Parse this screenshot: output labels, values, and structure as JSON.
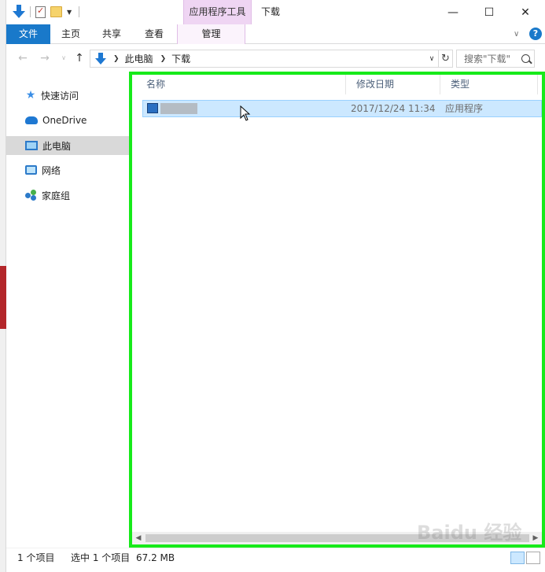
{
  "title_bar": {
    "contextual_tab_group": "应用程序工具",
    "window_title": "下载",
    "minimize": "—",
    "maximize": "☐",
    "close": "✕"
  },
  "ribbon": {
    "tabs": [
      {
        "label": "文件"
      },
      {
        "label": "主页"
      },
      {
        "label": "共享"
      },
      {
        "label": "查看"
      },
      {
        "label": "管理"
      }
    ],
    "help": "?"
  },
  "address": {
    "crumbs": [
      "此电脑",
      "下载"
    ],
    "search_placeholder": "搜索\"下载\""
  },
  "navigation": {
    "items": [
      {
        "label": "快速访问",
        "icon": "star-icon"
      },
      {
        "label": "OneDrive",
        "icon": "cloud-icon"
      },
      {
        "label": "此电脑",
        "icon": "computer-icon",
        "selected": true
      },
      {
        "label": "网络",
        "icon": "network-icon"
      },
      {
        "label": "家庭组",
        "icon": "homegroup-icon"
      }
    ]
  },
  "file_list": {
    "columns": [
      "名称",
      "修改日期",
      "类型"
    ],
    "rows": [
      {
        "name": "",
        "modified": "2017/12/24 11:34",
        "type": "应用程序"
      }
    ]
  },
  "status": {
    "item_count": "1 个项目",
    "selected": "选中 1 个项目",
    "size": "67.2 MB"
  },
  "watermark": "Baidu 经验",
  "colors": {
    "file_tab": "#1979ca",
    "contextual": "#efd5f3",
    "selection": "#cce8ff",
    "highlight_border": "#17ea1a"
  }
}
